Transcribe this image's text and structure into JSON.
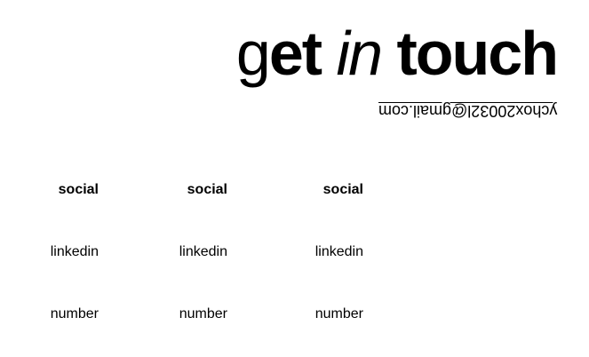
{
  "headline": {
    "part_light": "g",
    "part_bold_1": "et ",
    "part_italic": "in",
    "part_bold_2": " touch"
  },
  "contact": {
    "email": "ychox20032l@gmail.com"
  },
  "columns": [
    {
      "title": "social",
      "link": "linkedin",
      "info": "number"
    },
    {
      "title": "social",
      "link": "linkedin",
      "info": "number"
    },
    {
      "title": "social",
      "link": "linkedin",
      "info": "number"
    }
  ]
}
